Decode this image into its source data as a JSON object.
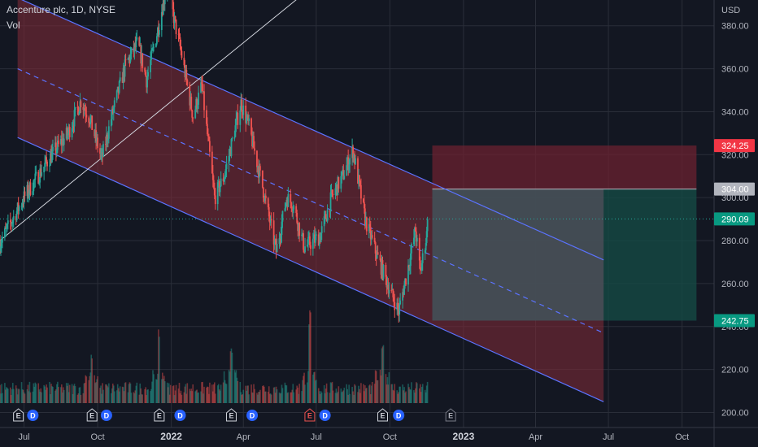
{
  "header": {
    "title": "Accenture plc, 1D, NYSE",
    "volume_label": "Vol"
  },
  "price_axis": {
    "currency": "USD",
    "ticks": [
      {
        "value": 380,
        "label": "380.00"
      },
      {
        "value": 360,
        "label": "360.00"
      },
      {
        "value": 340,
        "label": "340.00"
      },
      {
        "value": 320,
        "label": "320.00"
      },
      {
        "value": 300,
        "label": "300.00"
      },
      {
        "value": 280,
        "label": "280.00"
      },
      {
        "value": 260,
        "label": "260.00"
      },
      {
        "value": 240,
        "label": "240.00"
      },
      {
        "value": 220,
        "label": "220.00"
      },
      {
        "value": 200,
        "label": "200.00"
      }
    ],
    "price_tags": [
      {
        "value": 324.25,
        "label": "324.25",
        "color": "#f23645"
      },
      {
        "value": 304.0,
        "label": "304.00",
        "color": "#b2b5be"
      },
      {
        "value": 290.09,
        "label": "290.09",
        "color": "#089981"
      },
      {
        "value": 242.75,
        "label": "242.75",
        "color": "#089981"
      }
    ]
  },
  "time_axis": {
    "ticks": [
      {
        "date": "2021-07-01",
        "label": "Jul",
        "bold": false
      },
      {
        "date": "2021-10-01",
        "label": "Oct",
        "bold": false
      },
      {
        "date": "2022-01-01",
        "label": "2022",
        "bold": true
      },
      {
        "date": "2022-04-01",
        "label": "Apr",
        "bold": false
      },
      {
        "date": "2022-07-01",
        "label": "Jul",
        "bold": false
      },
      {
        "date": "2022-10-01",
        "label": "Oct",
        "bold": false
      },
      {
        "date": "2023-01-01",
        "label": "2023",
        "bold": true
      },
      {
        "date": "2023-04-01",
        "label": "Apr",
        "bold": false
      },
      {
        "date": "2023-07-01",
        "label": "Jul",
        "bold": false
      },
      {
        "date": "2023-10-01",
        "label": "Oct",
        "bold": false
      }
    ]
  },
  "events": [
    {
      "date": "2021-06-24",
      "label": "E",
      "kind": "earnings"
    },
    {
      "date": "2021-07-12",
      "label": "D",
      "kind": "dividend"
    },
    {
      "date": "2021-09-24",
      "label": "E",
      "kind": "earnings"
    },
    {
      "date": "2021-10-12",
      "label": "D",
      "kind": "dividend"
    },
    {
      "date": "2021-12-17",
      "label": "E",
      "kind": "earnings"
    },
    {
      "date": "2022-01-12",
      "label": "D",
      "kind": "dividend"
    },
    {
      "date": "2022-03-17",
      "label": "E",
      "kind": "earnings"
    },
    {
      "date": "2022-04-12",
      "label": "D",
      "kind": "dividend"
    },
    {
      "date": "2022-06-23",
      "label": "E",
      "kind": "earnings-miss"
    },
    {
      "date": "2022-07-12",
      "label": "D",
      "kind": "dividend"
    },
    {
      "date": "2022-09-22",
      "label": "E",
      "kind": "earnings"
    },
    {
      "date": "2022-10-12",
      "label": "D",
      "kind": "dividend"
    },
    {
      "date": "2022-12-16",
      "label": "E",
      "kind": "upcoming"
    }
  ],
  "colors": {
    "background": "#131722",
    "grid": "#2a2e39",
    "up": "#26a69a",
    "down": "#ef5350",
    "channel_line": "#5b73ff",
    "channel_fill": "#7c2a37",
    "stop_zone": "#6b2230",
    "target_zone": "#154a45",
    "projection_zone": "#4a4d57",
    "dividend": "#2962ff"
  },
  "chart_data": {
    "type": "candlestick",
    "symbol": "ACN",
    "interval": "1D",
    "ylim": [
      193,
      392
    ],
    "xlim": [
      "2021-06-01",
      "2023-11-10"
    ],
    "last_price": 290.09,
    "price_path": [
      [
        "2021-06-01",
        279
      ],
      [
        "2021-07-01",
        300
      ],
      [
        "2021-08-01",
        318
      ],
      [
        "2021-08-25",
        330
      ],
      [
        "2021-09-10",
        345
      ],
      [
        "2021-09-20",
        338
      ],
      [
        "2021-10-06",
        318
      ],
      [
        "2021-10-20",
        340
      ],
      [
        "2021-11-05",
        362
      ],
      [
        "2021-11-20",
        372
      ],
      [
        "2021-12-01",
        355
      ],
      [
        "2021-12-15",
        378
      ],
      [
        "2021-12-27",
        400
      ],
      [
        "2022-01-05",
        382
      ],
      [
        "2022-01-12",
        370
      ],
      [
        "2022-01-28",
        338
      ],
      [
        "2022-02-08",
        352
      ],
      [
        "2022-02-24",
        300
      ],
      [
        "2022-03-08",
        310
      ],
      [
        "2022-03-29",
        344
      ],
      [
        "2022-04-08",
        333
      ],
      [
        "2022-04-25",
        305
      ],
      [
        "2022-05-12",
        275
      ],
      [
        "2022-05-25",
        300
      ],
      [
        "2022-06-02",
        297
      ],
      [
        "2022-06-16",
        277
      ],
      [
        "2022-07-06",
        282
      ],
      [
        "2022-07-20",
        300
      ],
      [
        "2022-08-03",
        310
      ],
      [
        "2022-08-16",
        322
      ],
      [
        "2022-08-31",
        290
      ],
      [
        "2022-09-13",
        275
      ],
      [
        "2022-09-30",
        258
      ],
      [
        "2022-10-12",
        247
      ],
      [
        "2022-10-24",
        268
      ],
      [
        "2022-11-02",
        285
      ],
      [
        "2022-11-08",
        265
      ],
      [
        "2022-11-16",
        283
      ],
      [
        "2022-11-18",
        290
      ]
    ],
    "volume_peaks": [
      [
        "2021-09-24",
        1.0
      ],
      [
        "2021-12-17",
        1.5
      ],
      [
        "2022-03-17",
        1.2
      ],
      [
        "2022-06-23",
        1.9
      ],
      [
        "2022-09-22",
        1.3
      ]
    ],
    "channel": {
      "upper": {
        "start": [
          "2021-06-23",
          393
        ],
        "end": [
          "2023-06-25",
          271
        ]
      },
      "median": {
        "start": [
          "2021-06-23",
          360
        ],
        "end": [
          "2023-06-25",
          237
        ]
      },
      "lower": {
        "start": [
          "2021-06-23",
          328
        ],
        "end": [
          "2023-06-25",
          205
        ]
      }
    },
    "trend_line": {
      "start": [
        "2021-06-01",
        280
      ],
      "end": [
        "2022-06-09",
        393
      ]
    },
    "position": {
      "entry": 304.0,
      "stop": 324.25,
      "target": 242.75,
      "start": "2022-11-23",
      "end": "2023-10-19",
      "projection_start": "2022-11-23",
      "projection_end": "2023-06-25"
    }
  }
}
